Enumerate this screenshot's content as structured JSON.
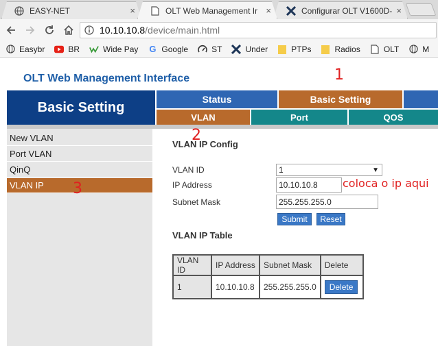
{
  "browser": {
    "tabs": [
      {
        "label": "EASY-NET",
        "icon": "globe-icon",
        "close": "×"
      },
      {
        "label": "OLT Web Management Ir",
        "icon": "page-icon",
        "close": "×"
      },
      {
        "label": "Configurar OLT V1600D-",
        "icon": "x-logo-icon",
        "close": "×"
      }
    ],
    "url": {
      "host": "10.10.10.8",
      "path": "/device/main.html"
    },
    "bookmarks": [
      {
        "label": "Easybr",
        "icon": "globe-icon"
      },
      {
        "label": "BR",
        "icon": "youtube-icon"
      },
      {
        "label": "Wide Pay",
        "icon": "widepay-icon"
      },
      {
        "label": "Google",
        "icon": "google-icon"
      },
      {
        "label": "ST",
        "icon": "speedometer-icon"
      },
      {
        "label": "Under",
        "icon": "x-logo-icon"
      },
      {
        "label": "PTPs",
        "icon": "folder-icon"
      },
      {
        "label": "Radios",
        "icon": "folder-icon"
      },
      {
        "label": "OLT",
        "icon": "page-icon"
      },
      {
        "label": "M",
        "icon": "globe-icon"
      }
    ]
  },
  "page": {
    "title": "OLT Web Management Interface",
    "hero": "Basic Setting",
    "main_nav": [
      {
        "label": "Status",
        "color": "#2f66b3"
      },
      {
        "label": "Basic Setting",
        "color": "#b86a2c"
      },
      {
        "label": "",
        "color": "#2f66b3"
      }
    ],
    "sub_nav": [
      {
        "label": "VLAN",
        "color": "#b86a2c"
      },
      {
        "label": "Port",
        "color": "#14878a"
      },
      {
        "label": "QOS",
        "color": "#14878a"
      }
    ],
    "sidebar": [
      {
        "label": "New VLAN",
        "active": false
      },
      {
        "label": "Port VLAN",
        "active": false
      },
      {
        "label": "QinQ",
        "active": false
      },
      {
        "label": "VLAN IP",
        "active": true
      }
    ],
    "config": {
      "title": "VLAN IP Config",
      "vlan_id_label": "VLAN ID",
      "vlan_id_value": "1",
      "ip_label": "IP Address",
      "ip_value": "10.10.10.8",
      "mask_label": "Subnet Mask",
      "mask_value": "255.255.255.0",
      "submit": "Submit",
      "reset": "Reset"
    },
    "table": {
      "title": "VLAN IP Table",
      "headers": [
        "VLAN ID",
        "IP Address",
        "Subnet Mask",
        "Delete"
      ],
      "rows": [
        {
          "vlan_id": "1",
          "ip": "10.10.10.8",
          "mask": "255.255.255.0",
          "delete": "Delete"
        }
      ]
    },
    "annotations": {
      "n1": "1",
      "n2": "2",
      "n3": "3",
      "note": "coloca o ip aqui"
    },
    "colors": {
      "brand_blue": "#1f5fa8",
      "hero_navy": "#0d3f86",
      "active_orange": "#b86a2c",
      "teal": "#14878a",
      "annotation_red": "#e02020"
    }
  }
}
